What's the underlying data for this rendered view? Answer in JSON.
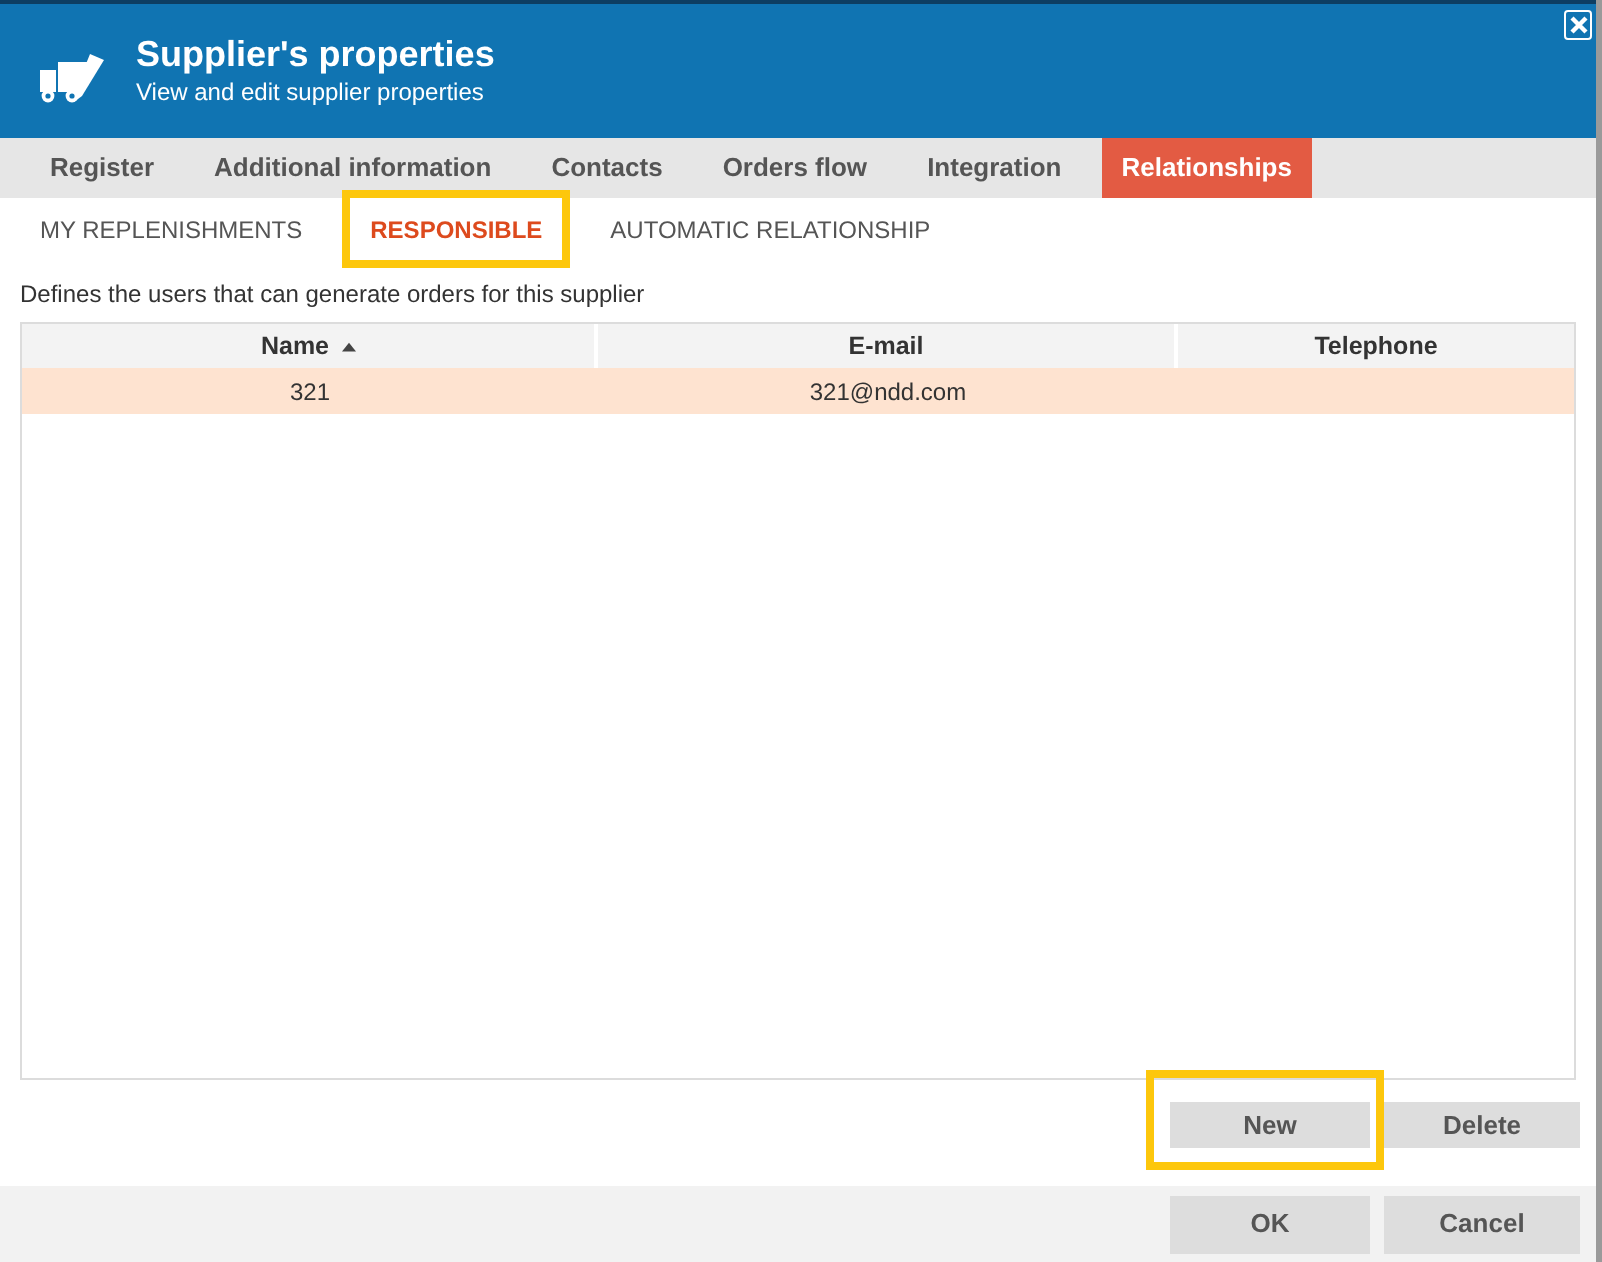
{
  "window": {
    "title": "Supplier's properties",
    "subtitle": "View and edit supplier properties"
  },
  "tabs": [
    {
      "label": "Register",
      "selected": false
    },
    {
      "label": "Additional information",
      "selected": false
    },
    {
      "label": "Contacts",
      "selected": false
    },
    {
      "label": "Orders flow",
      "selected": false
    },
    {
      "label": "Integration",
      "selected": false
    },
    {
      "label": "Relationships",
      "selected": true
    }
  ],
  "subtabs": [
    {
      "label": "MY REPLENISHMENTS",
      "selected": false,
      "highlighted": false
    },
    {
      "label": "RESPONSIBLE",
      "selected": true,
      "highlighted": true
    },
    {
      "label": "AUTOMATIC RELATIONSHIP",
      "selected": false,
      "highlighted": false
    }
  ],
  "description": "Defines the users that can generate orders for this supplier",
  "table": {
    "columns": [
      {
        "label": "Name",
        "sorted": true
      },
      {
        "label": "E-mail",
        "sorted": false
      },
      {
        "label": "Telephone",
        "sorted": false
      }
    ],
    "rows": [
      {
        "cells": [
          "321",
          "321@ndd.com"
        ],
        "selected": true
      }
    ]
  },
  "table_actions": [
    {
      "label": "New",
      "highlighted": true
    },
    {
      "label": "Delete",
      "highlighted": false
    }
  ],
  "footer_buttons": [
    {
      "label": "OK"
    },
    {
      "label": "Cancel"
    }
  ]
}
